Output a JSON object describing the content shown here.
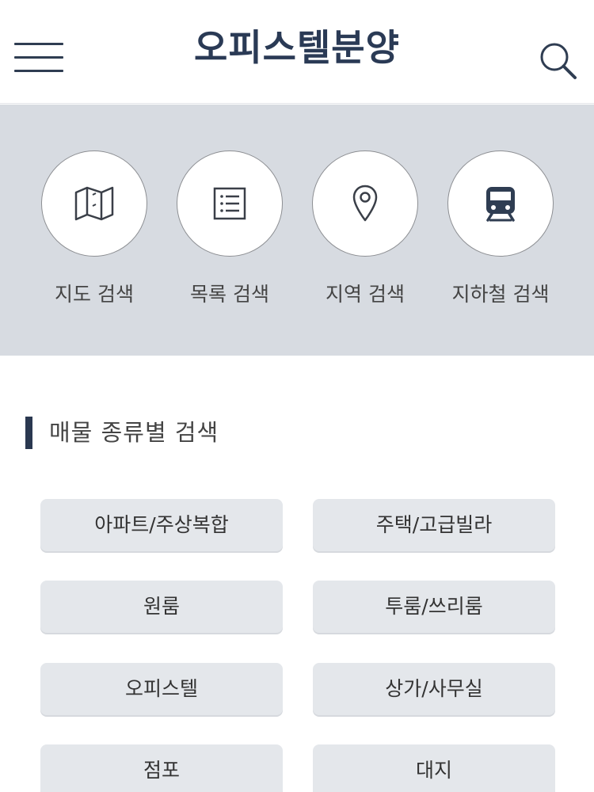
{
  "header": {
    "title": "오피스텔분양",
    "menu_icon": "hamburger-menu-icon",
    "search_icon": "search-icon"
  },
  "quick_search": [
    {
      "label": "지도 검색",
      "icon": "map-icon"
    },
    {
      "label": "목록 검색",
      "icon": "list-icon"
    },
    {
      "label": "지역 검색",
      "icon": "location-pin-icon"
    },
    {
      "label": "지하철 검색",
      "icon": "subway-icon"
    }
  ],
  "property_section": {
    "title": "매물 종류별 검색",
    "items": [
      "아파트/주상복합",
      "주택/고급빌라",
      "원룸",
      "투룸/쓰리룸",
      "오피스텔",
      "상가/사무실",
      "점포",
      "대지"
    ]
  },
  "colors": {
    "brand_navy": "#2a3a55",
    "quick_bg": "#d7dbe1",
    "button_bg": "#e4e7eb"
  }
}
